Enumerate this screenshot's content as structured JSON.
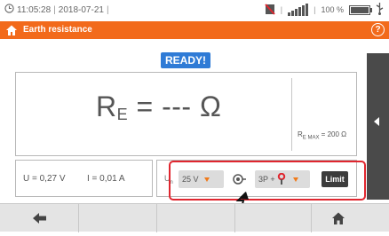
{
  "status_bar": {
    "time": "11:05:28",
    "date": "2018-07-21",
    "battery_percent_label": "100 %",
    "battery_level": 1.0,
    "signal_icon": "signal-bars-icon",
    "sim_icon": "no-sim-icon",
    "usb_icon": "usb-icon"
  },
  "title_bar": {
    "title": "Earth resistance",
    "home_icon": "home-icon",
    "help_label": "?"
  },
  "status_badge": "READY!",
  "result": {
    "symbol": "R",
    "subscript": "E",
    "value_text": " = --- Ω",
    "limit_prefix": "R",
    "limit_sub": "E MAX",
    "limit_value": " = 200 Ω"
  },
  "readings": {
    "voltage": "U = 0,27 V",
    "current": "I = 0,01 A"
  },
  "settings": {
    "un_label": "U",
    "un_sub": "n",
    "voltage_value": "25 V",
    "mode_value": "3P +",
    "limit_label": "Limit"
  },
  "colors": {
    "title_bar": "#f26a1b",
    "status_badge": "#2f7bd6",
    "highlight": "#e0262f",
    "side_tab": "#4a4a4a",
    "limit_button": "#3c3c3c",
    "select_arrow": "#f07a1a"
  }
}
